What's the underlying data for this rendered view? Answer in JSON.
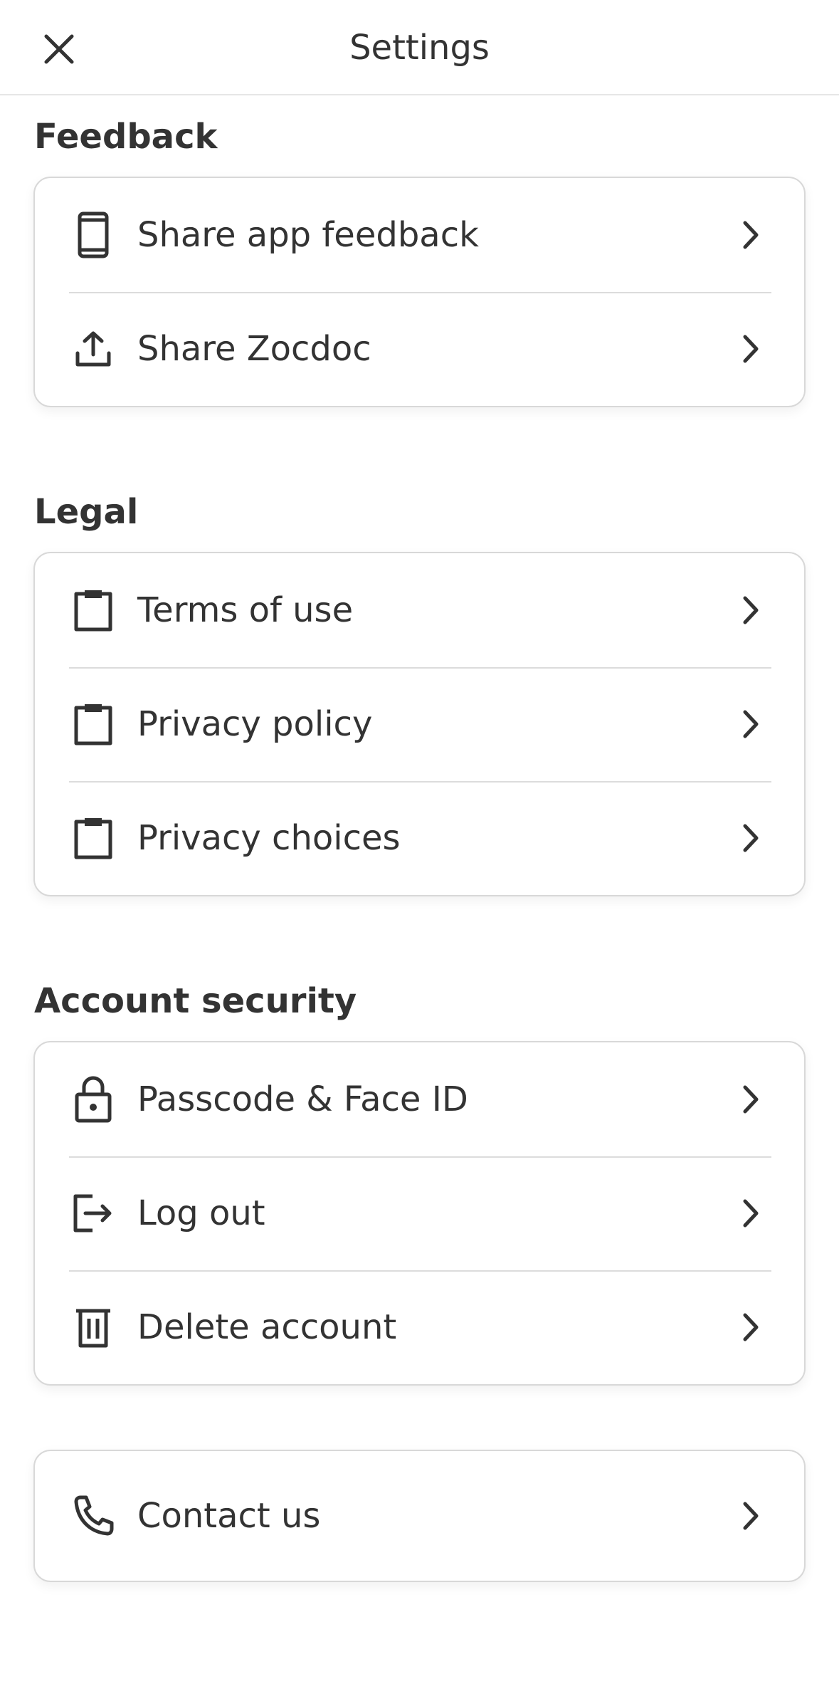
{
  "header": {
    "title": "Settings",
    "close_icon": "close-icon"
  },
  "sections": [
    {
      "title": "Feedback",
      "items": [
        {
          "label": "Share app feedback",
          "icon": "phone-icon"
        },
        {
          "label": "Share Zocdoc",
          "icon": "share-upload-icon"
        }
      ]
    },
    {
      "title": "Legal",
      "items": [
        {
          "label": "Terms of use",
          "icon": "clipboard-icon"
        },
        {
          "label": "Privacy policy",
          "icon": "clipboard-icon"
        },
        {
          "label": "Privacy choices",
          "icon": "clipboard-icon"
        }
      ]
    },
    {
      "title": "Account security",
      "items": [
        {
          "label": "Passcode & Face ID",
          "icon": "lock-icon"
        },
        {
          "label": "Log out",
          "icon": "logout-icon"
        },
        {
          "label": "Delete account",
          "icon": "trash-icon"
        }
      ]
    },
    {
      "title": "",
      "items": [
        {
          "label": "Contact us",
          "icon": "phone-call-icon"
        }
      ]
    }
  ],
  "colors": {
    "text": "#333333",
    "border": "#d8d8d8",
    "divider": "#dcdcdc",
    "background": "#ffffff"
  }
}
